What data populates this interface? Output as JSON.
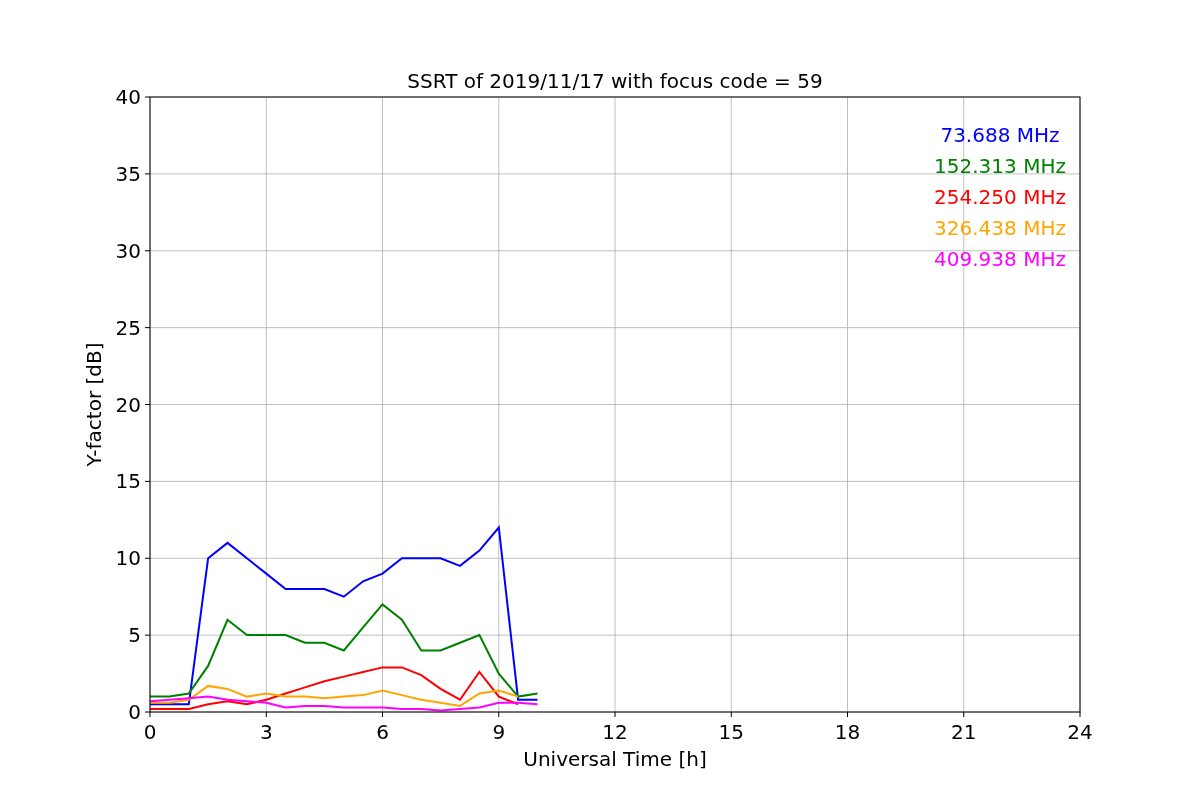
{
  "figure": {
    "chart_data": {
      "type": "line",
      "title": "SSRT of 2019/11/17 with focus code = 59",
      "xlabel": "Universal Time [h]",
      "ylabel": "Y-factor [dB]",
      "x": [
        0,
        0.5,
        1,
        1.5,
        2,
        2.5,
        3,
        3.5,
        4,
        4.5,
        5,
        5.5,
        6,
        6.5,
        7,
        7.5,
        8,
        8.5,
        9,
        9.5,
        10
      ],
      "series": [
        {
          "name": "73.688 MHz",
          "color": "#0000ff",
          "values": [
            0.5,
            0.5,
            0.5,
            10,
            11,
            10,
            9,
            8,
            8,
            8,
            7.5,
            8.5,
            9,
            10,
            10,
            10,
            9.5,
            10.5,
            12,
            0.8,
            0.8
          ]
        },
        {
          "name": "152.313 MHz",
          "color": "#008000",
          "values": [
            1,
            1,
            1.2,
            3,
            6,
            5,
            5,
            5,
            4.5,
            4.5,
            4,
            5.5,
            7,
            6,
            4,
            4,
            4.5,
            5,
            2.5,
            1,
            1.2
          ]
        },
        {
          "name": "254.250 MHz",
          "color": "#ff0000",
          "values": [
            0.2,
            0.2,
            0.2,
            0.5,
            0.7,
            0.5,
            0.8,
            1.2,
            1.6,
            2,
            2.3,
            2.6,
            2.9,
            2.9,
            2.4,
            1.5,
            0.8,
            2.6,
            1,
            0.5,
            null
          ]
        },
        {
          "name": "326.438 MHz",
          "color": "#ffa500",
          "values": [
            0.6,
            0.6,
            0.8,
            1.7,
            1.5,
            1,
            1.2,
            1,
            1,
            0.9,
            1,
            1.1,
            1.4,
            1.1,
            0.8,
            0.6,
            0.4,
            1.2,
            1.4,
            1,
            null
          ]
        },
        {
          "name": "409.938 MHz",
          "color": "#ff00ff",
          "values": [
            0.7,
            0.8,
            0.9,
            1,
            0.8,
            0.7,
            0.6,
            0.3,
            0.4,
            0.4,
            0.3,
            0.3,
            0.3,
            0.2,
            0.2,
            0.1,
            0.2,
            0.3,
            0.6,
            0.6,
            0.5
          ]
        }
      ],
      "xlim": [
        0,
        24
      ],
      "ylim": [
        0,
        40
      ],
      "xticks": [
        0,
        3,
        6,
        9,
        12,
        15,
        18,
        21,
        24
      ],
      "yticks": [
        0,
        5,
        10,
        15,
        20,
        25,
        30,
        35,
        40
      ],
      "grid": true
    }
  }
}
